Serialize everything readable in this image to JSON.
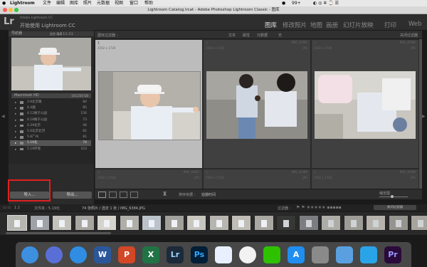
{
  "menubar": {
    "items": [
      "Lightroom",
      "文件",
      "编辑",
      "图库",
      "照片",
      "元数据",
      "视图",
      "窗口",
      "帮助"
    ],
    "right": [
      "99+"
    ]
  },
  "window": {
    "title": "Lightroom Catalog.lrcat - Adobe Photoshop Lightroom Classic - 图库"
  },
  "header": {
    "logo": "Lr",
    "brand_line1": "Adobe Lightroom CC",
    "brand_line2": "开始使用 Lightroom CC",
    "modules": [
      "图库",
      "修改照片",
      "地图",
      "画册",
      "幻灯片放映",
      "打印",
      "Web"
    ],
    "active_module": "图库"
  },
  "left_panel": {
    "navigator_label": "导航器",
    "navigator_opts": "适合  填满  1:1  3:1",
    "volume_name": "Macintosh HD",
    "volume_info": "101/250 GB",
    "folders": [
      {
        "name": "3.9北京路",
        "count": "84"
      },
      {
        "name": "4.4烟",
        "count": "85"
      },
      {
        "name": "4.12植于公园",
        "count": "156"
      },
      {
        "name": "4.18植于公园",
        "count": "73"
      },
      {
        "name": "4.29北京",
        "count": "46"
      },
      {
        "name": "5.6北京北河",
        "count": "81"
      },
      {
        "name": "5.6广州",
        "count": "81"
      },
      {
        "name": "5.19北",
        "count": "74"
      },
      {
        "name": "5.19环境",
        "count": "153"
      }
    ],
    "import_label": "导入...",
    "export_label": "导出..."
  },
  "grid": {
    "top_labels": [
      "图库过滤器 :",
      "文本",
      "属性",
      "元数据",
      "无"
    ],
    "top_right": "关闭过滤器",
    "cells": [
      {
        "num": "1",
        "dims": "2592 x 1728",
        "name": "IMG_6384",
        "fmt": "JPG"
      },
      {
        "num": "2",
        "dims": "2592 x 1728",
        "name": "IMG_6385",
        "fmt": "JPG"
      },
      {
        "num": "3",
        "dims": "2592 x 1728",
        "name": "IMG_6386",
        "fmt": "JPG"
      },
      {
        "num": "4",
        "dims": "2592 x 1728",
        "name": "IMG_6387",
        "fmt": "JPG"
      },
      {
        "num": "5",
        "dims": "2592 x 1728",
        "name": "IMG_6388",
        "fmt": "JPG"
      },
      {
        "num": "6",
        "dims": "2592 x 1728",
        "name": "IMG_6389",
        "fmt": "JPG"
      }
    ]
  },
  "toolbar": {
    "sort_label": "排序依据 :",
    "sort_value": "拍摄时间",
    "thumb_label": "缩览图"
  },
  "status": {
    "pages": "1 2",
    "path": "文件夹 : 5.19北",
    "summary": "74 张照片 / 选定 1 张 / IMG_6384.JPG",
    "filter_label": "过滤器 :",
    "filter_value": "关闭过滤器"
  },
  "dock": {
    "apps": [
      "Finder",
      "Siri",
      "Safari",
      "Word",
      "PowerPoint",
      "Excel",
      "Lightroom",
      "Photoshop",
      "Baidu",
      "Photos",
      "WeChat",
      "App Store",
      "System Preferences",
      "Preview",
      "QuickTime",
      "Premiere"
    ],
    "labels": [
      "",
      "",
      "",
      "W",
      "P",
      "X",
      "Lr",
      "Ps",
      "",
      "",
      "",
      "A",
      "",
      "",
      "",
      "Pr"
    ]
  },
  "colors": {
    "highlight_box": "#e02020",
    "lr_blue": "#31a8ff",
    "ps_blue": "#31a8ff",
    "pr_purple": "#9999ff"
  }
}
